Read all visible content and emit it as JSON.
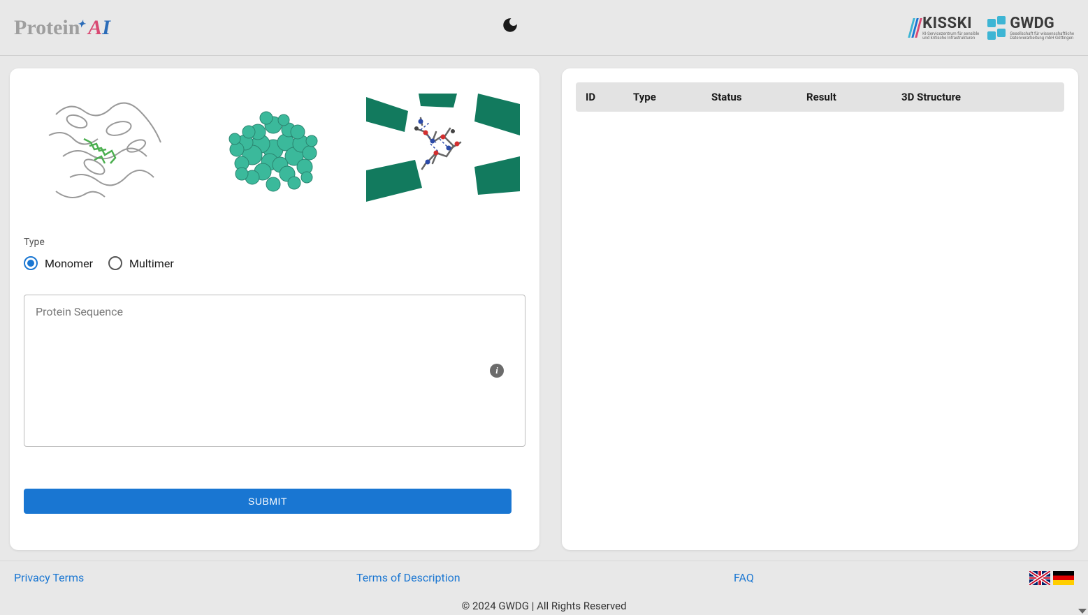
{
  "header": {
    "logo_prefix": "Protein",
    "logo_a": "A",
    "logo_i": "I"
  },
  "form": {
    "type_label": "Type",
    "radio_options": [
      {
        "label": "Monomer",
        "selected": true
      },
      {
        "label": "Multimer",
        "selected": false
      }
    ],
    "sequence_placeholder": "Protein Sequence",
    "submit_label": "SUBMIT"
  },
  "table": {
    "headers": {
      "id": "ID",
      "type": "Type",
      "status": "Status",
      "result": "Result",
      "structure": "3D Structure"
    },
    "rows": []
  },
  "footer": {
    "links": {
      "privacy": "Privacy Terms",
      "terms": "Terms of Description",
      "faq": "FAQ"
    },
    "copyright": "© 2024 GWDG | All Rights Reserved"
  },
  "partner_logos": {
    "kisski": "KISSKI",
    "gwdg": "GWDG"
  }
}
